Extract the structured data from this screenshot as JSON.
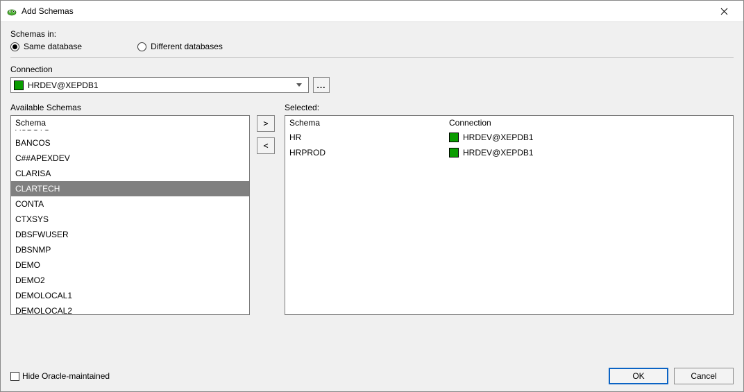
{
  "window": {
    "title": "Add Schemas"
  },
  "schemas_in_label": "Schemas in:",
  "radios": {
    "same": "Same database",
    "different": "Different databases"
  },
  "connection": {
    "label": "Connection",
    "value": "HRDEV@XEPDB1",
    "browse": "...",
    "swatch_color": "#0a9c00"
  },
  "available": {
    "label": "Available Schemas",
    "header": "Schema",
    "items": [
      {
        "name": "AUDSYS"
      },
      {
        "name": "BANCOS"
      },
      {
        "name": "C##APEXDEV"
      },
      {
        "name": "CLARISA"
      },
      {
        "name": "CLARTECH",
        "selected": true
      },
      {
        "name": "CONTA"
      },
      {
        "name": "CTXSYS"
      },
      {
        "name": "DBSFWUSER"
      },
      {
        "name": "DBSNMP"
      },
      {
        "name": "DEMO"
      },
      {
        "name": "DEMO2"
      },
      {
        "name": "DEMOLOCAL1"
      },
      {
        "name": "DEMOLOCAL2"
      }
    ]
  },
  "move": {
    "add": ">",
    "remove": "<"
  },
  "selected": {
    "label": "Selected:",
    "header_schema": "Schema",
    "header_connection": "Connection",
    "rows": [
      {
        "schema": "HR",
        "connection": "HRDEV@XEPDB1"
      },
      {
        "schema": "HRPROD",
        "connection": "HRDEV@XEPDB1"
      }
    ]
  },
  "hide_checkbox": "Hide Oracle-maintained",
  "buttons": {
    "ok": "OK",
    "cancel": "Cancel"
  }
}
